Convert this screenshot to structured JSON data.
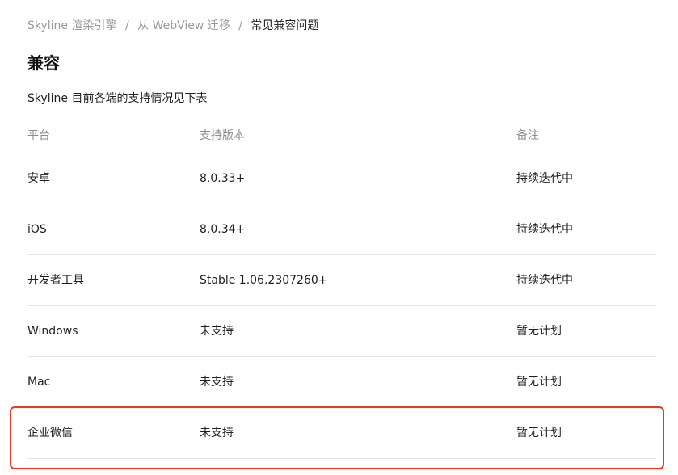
{
  "breadcrumb": {
    "items": [
      "Skyline 渲染引擎",
      "从 WebView 迁移"
    ],
    "current": "常见兼容问题",
    "separator": "/"
  },
  "page": {
    "title": "兼容",
    "intro": "Skyline 目前各端的支持情况见下表"
  },
  "table": {
    "headers": [
      "平台",
      "支持版本",
      "备注"
    ],
    "rows": [
      [
        "安卓",
        "8.0.33+",
        "持续迭代中"
      ],
      [
        "iOS",
        "8.0.34+",
        "持续迭代中"
      ],
      [
        "开发者工具",
        "Stable 1.06.2307260+",
        "持续迭代中"
      ],
      [
        "Windows",
        "未支持",
        "暂无计划"
      ],
      [
        "Mac",
        "未支持",
        "暂无计划"
      ],
      [
        "企业微信",
        "未支持",
        "暂无计划"
      ]
    ]
  },
  "colors": {
    "highlight": "#e8391e",
    "muted_text": "#9a9a9a",
    "text": "#1f1f1f"
  }
}
